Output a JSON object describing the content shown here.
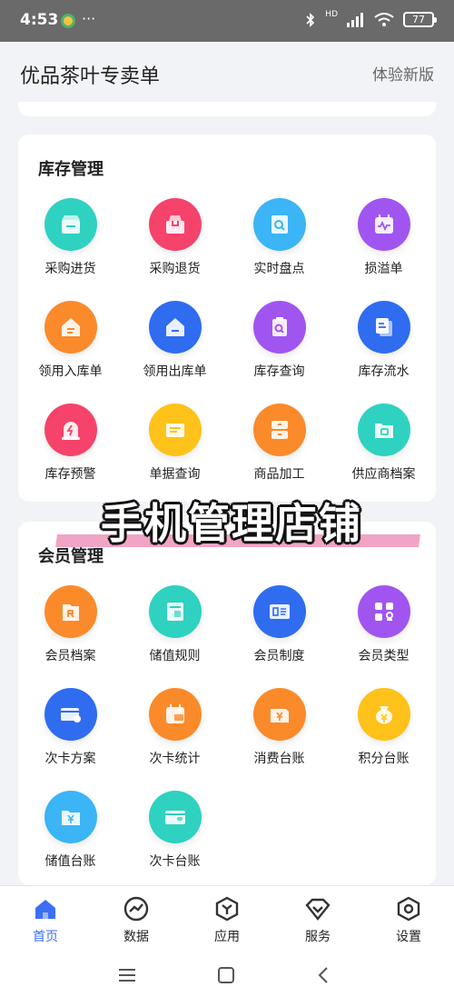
{
  "status_bar": {
    "time": "4:53",
    "more": "···",
    "network": "HD",
    "battery": "77"
  },
  "header": {
    "title": "优品茶叶专卖单",
    "link": "体验新版"
  },
  "inventory": {
    "title": "库存管理",
    "items": [
      {
        "label": "采购进货",
        "icon": "box-in-icon",
        "color": "#2fd1c0"
      },
      {
        "label": "采购退货",
        "icon": "box-return-icon",
        "color": "#f5436b"
      },
      {
        "label": "实时盘点",
        "icon": "inspect-box-icon",
        "color": "#3bb5f5"
      },
      {
        "label": "损溢单",
        "icon": "calendar-wave-icon",
        "color": "#a155f0"
      },
      {
        "label": "领用入库单",
        "icon": "house-in-icon",
        "color": "#fb8a2b"
      },
      {
        "label": "领用出库单",
        "icon": "house-out-icon",
        "color": "#2f6cf0"
      },
      {
        "label": "库存查询",
        "icon": "clipboard-search-icon",
        "color": "#a155f0"
      },
      {
        "label": "库存流水",
        "icon": "document-stack-icon",
        "color": "#2f6cf0"
      },
      {
        "label": "库存预警",
        "icon": "alarm-icon",
        "color": "#f5436b"
      },
      {
        "label": "单据查询",
        "icon": "ticket-icon",
        "color": "#ffc21a"
      },
      {
        "label": "商品加工",
        "icon": "stacked-boxes-icon",
        "color": "#fb8a2b"
      },
      {
        "label": "供应商档案",
        "icon": "folder-icon",
        "color": "#2fd1c0"
      }
    ]
  },
  "banner": {
    "text": "手机管理店铺"
  },
  "members": {
    "title": "会员管理",
    "items": [
      {
        "label": "会员档案",
        "icon": "member-folder-icon",
        "color": "#fb8a2b"
      },
      {
        "label": "储值规则",
        "icon": "ledger-icon",
        "color": "#2fd1c0"
      },
      {
        "label": "会员制度",
        "icon": "id-card-icon",
        "color": "#2f6cf0"
      },
      {
        "label": "会员类型",
        "icon": "grid-user-icon",
        "color": "#a155f0"
      },
      {
        "label": "次卡方案",
        "icon": "card-icon",
        "color": "#2f6cf0"
      },
      {
        "label": "次卡统计",
        "icon": "calendar-card-icon",
        "color": "#fb8a2b"
      },
      {
        "label": "消费台账",
        "icon": "wallet-yen-icon",
        "color": "#fb8a2b"
      },
      {
        "label": "积分台账",
        "icon": "coin-bag-icon",
        "color": "#ffc21a"
      },
      {
        "label": "储值台账",
        "icon": "folder-yen-icon",
        "color": "#3bb5f5"
      },
      {
        "label": "次卡台账",
        "icon": "card-wallet-icon",
        "color": "#2fd1c0"
      }
    ]
  },
  "tabs": [
    {
      "label": "首页",
      "icon": "home-icon",
      "active": true
    },
    {
      "label": "数据",
      "icon": "chart-icon",
      "active": false
    },
    {
      "label": "应用",
      "icon": "apps-icon",
      "active": false
    },
    {
      "label": "服务",
      "icon": "service-icon",
      "active": false
    },
    {
      "label": "设置",
      "icon": "settings-icon",
      "active": false
    }
  ],
  "colors": {
    "accent": "#3b6ff5",
    "background": "#f2f3f7"
  }
}
